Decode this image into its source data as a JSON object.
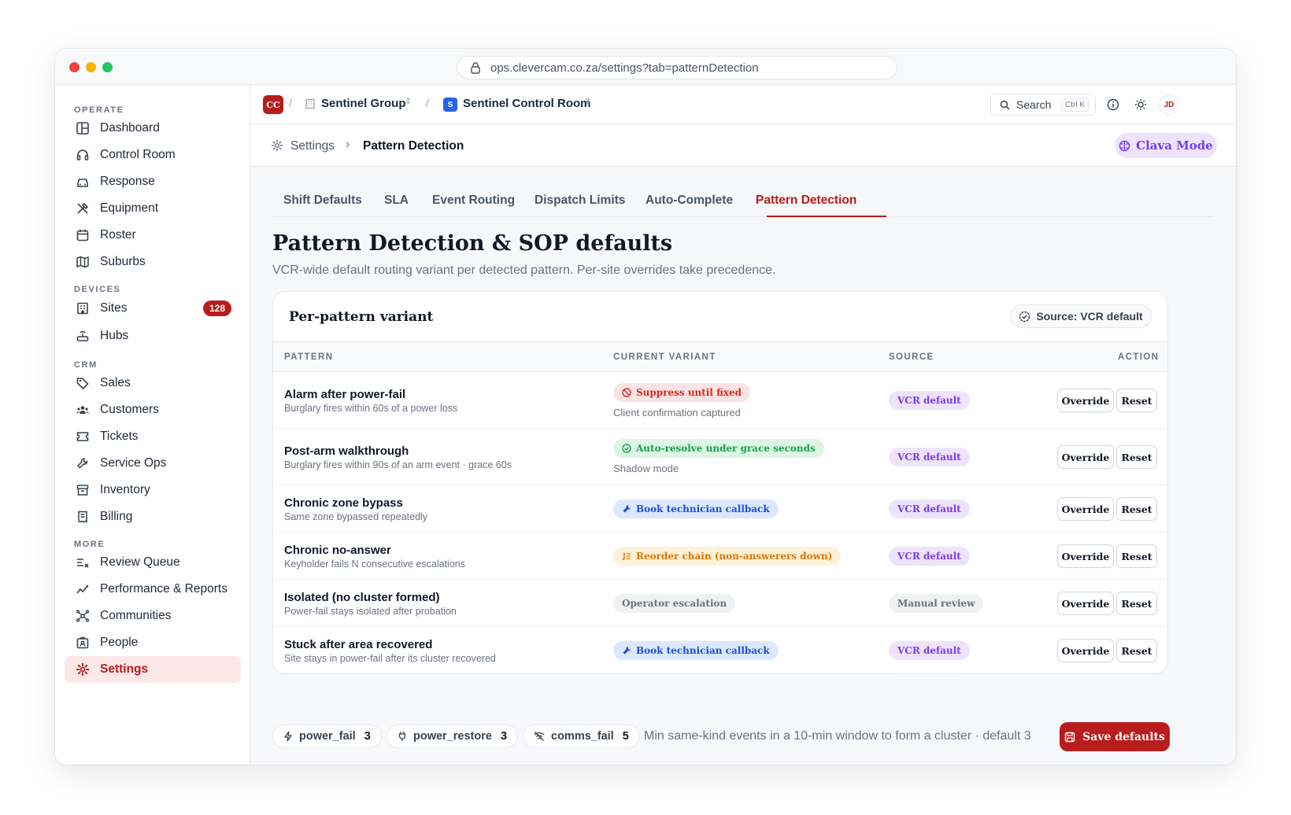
{
  "browser": {
    "url": "ops.clevercam.co.za/settings?tab=patternDetection"
  },
  "sidebar": {
    "sections": {
      "operate": "OPERATE",
      "devices": "DEVICES",
      "crm": "CRM",
      "more": "MORE"
    },
    "items": {
      "dashboard": "Dashboard",
      "control_room": "Control Room",
      "response": "Response",
      "equipment": "Equipment",
      "roster": "Roster",
      "suburbs": "Suburbs",
      "sites": "Sites",
      "sites_count": "128",
      "hubs": "Hubs",
      "sales": "Sales",
      "customers": "Customers",
      "tickets": "Tickets",
      "service_ops": "Service Ops",
      "inventory": "Inventory",
      "billing": "Billing",
      "review_queue": "Review Queue",
      "performance": "Performance & Reports",
      "communities": "Communities",
      "people": "People",
      "settings": "Settings"
    }
  },
  "topbar": {
    "logo": "CC",
    "org": "Sentinel Group",
    "room_badge": "S",
    "room": "Sentinel Control Room",
    "search_label": "Search",
    "search_shortcut": "Ctrl K",
    "avatar": "JD"
  },
  "breadcrumb": {
    "root": "Settings",
    "current": "Pattern Detection",
    "mode_button": "Clava Mode"
  },
  "tabs": [
    "Shift Defaults",
    "SLA",
    "Event Routing",
    "Dispatch Limits",
    "Auto-Complete",
    "Pattern Detection"
  ],
  "page": {
    "title": "Pattern Detection & SOP defaults",
    "subtitle": "VCR-wide default routing variant per detected pattern. Per-site overrides take precedence."
  },
  "card": {
    "title": "Per-pattern variant",
    "source_pill": "Source: VCR default",
    "columns": [
      "PATTERN",
      "CURRENT VARIANT",
      "SOURCE",
      "ACTION"
    ],
    "rows": [
      {
        "name": "Alarm after power-fail",
        "desc": "Burglary fires within 60s of a power loss",
        "variant": "Suppress until fixed",
        "note": "Client confirmation captured",
        "source": "VCR default",
        "override": "Override",
        "reset": "Reset"
      },
      {
        "name": "Post-arm walkthrough",
        "desc": "Burglary fires within 90s of an arm event · grace 60s",
        "variant": "Auto-resolve under grace seconds",
        "note": "Shadow mode",
        "source": "VCR default",
        "override": "Override",
        "reset": "Reset"
      },
      {
        "name": "Chronic zone bypass",
        "desc": "Same zone bypassed repeatedly",
        "variant": "Book technician callback",
        "source": "VCR default",
        "override": "Override",
        "reset": "Reset"
      },
      {
        "name": "Chronic no-answer",
        "desc": "Keyholder fails N consecutive escalations",
        "variant": "Reorder chain (non-answerers down)",
        "source": "VCR default",
        "override": "Override",
        "reset": "Reset"
      },
      {
        "name": "Isolated (no cluster formed)",
        "desc": "Power-fail stays isolated after probation",
        "variant": "Operator escalation",
        "source": "Manual review",
        "override": "Override",
        "reset": "Reset"
      },
      {
        "name": "Stuck after area recovered",
        "desc": "Site stays in power-fail after its cluster recovered",
        "variant": "Book technician callback",
        "source": "VCR default",
        "override": "Override",
        "reset": "Reset"
      }
    ]
  },
  "footer": {
    "thresholds": [
      {
        "label": "power_fail",
        "count": "3",
        "icon": "bolt-icon"
      },
      {
        "label": "power_restore",
        "count": "3",
        "icon": "plug-icon"
      },
      {
        "label": "comms_fail",
        "count": "5",
        "icon": "wifi-off-icon"
      }
    ],
    "hint": "Min same-kind events in a 10-min window to form a cluster · default 3",
    "save": "Save defaults"
  },
  "colors": {
    "accent": "#b91c1c",
    "purple": "#7c3aed",
    "green": "#16a34a",
    "blue": "#1d4ed8",
    "amber": "#d97706"
  }
}
